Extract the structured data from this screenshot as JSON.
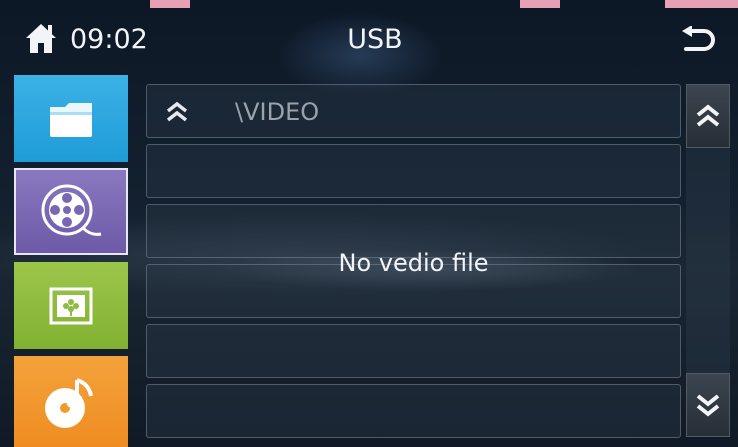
{
  "header": {
    "clock": "09:02",
    "title": "USB",
    "home_icon": "home-icon",
    "back_icon": "back-arrow-icon"
  },
  "sidebar": {
    "items": [
      {
        "id": "folder",
        "icon": "folder-icon",
        "color": "#2aa6df"
      },
      {
        "id": "video",
        "icon": "film-reel-icon",
        "color": "#7a67b3",
        "selected": true
      },
      {
        "id": "photo",
        "icon": "picture-icon",
        "color": "#8fbc3c"
      },
      {
        "id": "music",
        "icon": "music-disc-icon",
        "color": "#f29a2e"
      }
    ]
  },
  "file_list": {
    "path": "\\VIDEO",
    "empty_message": "No vedio file"
  },
  "scrollbar": {
    "up_icon": "double-chevron-up-icon",
    "down_icon": "double-chevron-down-icon"
  }
}
